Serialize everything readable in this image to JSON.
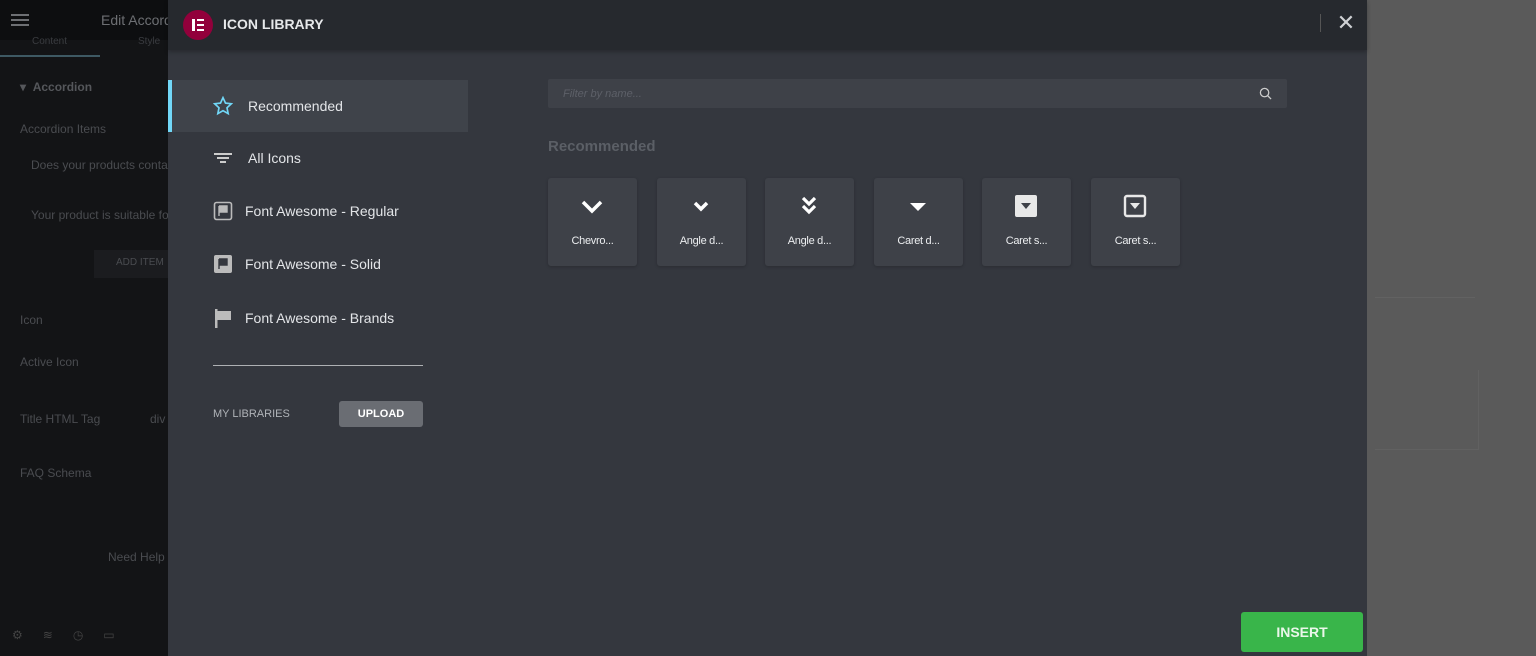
{
  "editor": {
    "title": "Edit Accordion",
    "tabs": [
      "Content",
      "Style"
    ],
    "section": "Accordion",
    "items_label": "Accordion Items",
    "items": [
      "Does your products contain",
      "Your product is suitable for"
    ],
    "add_item": "ADD ITEM",
    "fields": [
      "Icon",
      "Active Icon",
      "Title HTML Tag",
      "FAQ Schema"
    ],
    "title_tag_value": "div",
    "need_help": "Need Help"
  },
  "modal": {
    "title": "ICON LIBRARY",
    "nav": [
      {
        "label": "Recommended",
        "icon": "star-icon",
        "active": true
      },
      {
        "label": "All Icons",
        "icon": "filter-icon"
      },
      {
        "label": "Font Awesome - Regular",
        "icon": "flag-regular-icon"
      },
      {
        "label": "Font Awesome - Solid",
        "icon": "flag-solid-icon"
      },
      {
        "label": "Font Awesome - Brands",
        "icon": "flag-icon"
      }
    ],
    "my_libraries": "MY LIBRARIES",
    "upload": "UPLOAD",
    "search": {
      "placeholder": "Filter by name...",
      "value": ""
    },
    "section_heading": "Recommended",
    "icons": [
      {
        "label": "Chevro...",
        "icon": "chevron-down-icon"
      },
      {
        "label": "Angle d...",
        "icon": "angle-down-icon"
      },
      {
        "label": "Angle d...",
        "icon": "angle-double-down-icon"
      },
      {
        "label": "Caret d...",
        "icon": "caret-down-icon"
      },
      {
        "label": "Caret s...",
        "icon": "caret-square-down-solid-icon"
      },
      {
        "label": "Caret s...",
        "icon": "caret-square-down-regular-icon"
      }
    ],
    "insert": "INSERT"
  },
  "colors": {
    "accent": "#71d7f7",
    "insert": "#39b54a",
    "logo": "#92003b"
  }
}
